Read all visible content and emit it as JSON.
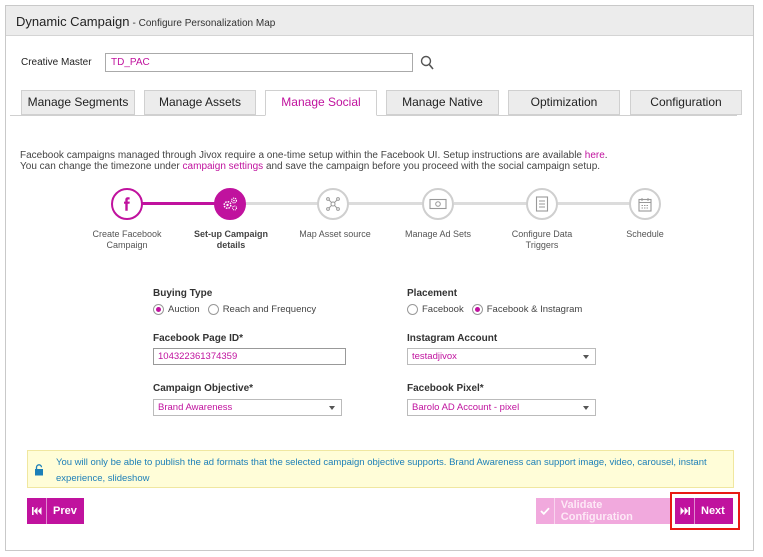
{
  "header": {
    "title": "Dynamic Campaign",
    "subtitle": "- Configure Personalization Map"
  },
  "creative_master": {
    "label": "Creative Master",
    "value": "TD_PAC",
    "search_icon": "search-icon"
  },
  "tabs": [
    {
      "label": "Manage Segments"
    },
    {
      "label": "Manage Assets"
    },
    {
      "label": "Manage Social",
      "active": true
    },
    {
      "label": "Manage Native"
    },
    {
      "label": "Optimization"
    },
    {
      "label": "Configuration"
    }
  ],
  "info": {
    "line1_text": "Facebook campaigns managed through Jivox require a one-time setup within the Facebook UI. Setup instructions are available",
    "line1_link": "here",
    "line1_end": ".",
    "line2_start": "You can change the timezone under",
    "line2_link": "campaign settings",
    "line2_end": "and save the campaign before you proceed with the social campaign setup."
  },
  "steps": [
    {
      "label": "Create Facebook Campaign",
      "icon": "facebook-icon",
      "state": "done"
    },
    {
      "label": "Set-up Campaign details",
      "icon": "settings-gears-icon",
      "state": "current"
    },
    {
      "label": "Map Asset source",
      "icon": "share-nodes-icon",
      "state": "todo"
    },
    {
      "label": "Manage Ad Sets",
      "icon": "money-icon",
      "state": "todo"
    },
    {
      "label": "Configure Data Triggers",
      "icon": "checklist-icon",
      "state": "todo"
    },
    {
      "label": "Schedule",
      "icon": "calendar-icon",
      "state": "todo"
    }
  ],
  "form": {
    "buying_type": {
      "label": "Buying Type",
      "options": [
        "Auction",
        "Reach and Frequency"
      ],
      "selected": "Auction"
    },
    "placement": {
      "label": "Placement",
      "options": [
        "Facebook",
        "Facebook & Instagram"
      ],
      "selected": "Facebook & Instagram"
    },
    "page_id": {
      "label": "Facebook Page ID*",
      "value": "104322361374359"
    },
    "instagram": {
      "label": "Instagram Account",
      "value": "testadjivox"
    },
    "objective": {
      "label": "Campaign Objective*",
      "value": "Brand Awareness"
    },
    "pixel": {
      "label": "Facebook Pixel*",
      "value": "Barolo AD Account - pixel"
    }
  },
  "notice": {
    "icon": "lock-icon",
    "text": "You will only be able to publish the ad formats that the selected campaign objective supports. Brand Awareness can support image, video, carousel, instant experience, slideshow"
  },
  "buttons": {
    "prev": "Prev",
    "validate": "Validate Configuration",
    "next": "Next"
  },
  "colors": {
    "accent": "#c0129e",
    "accent_light": "#f1a9dd",
    "notice_bg": "#fffdd8",
    "highlight": "#e81a14"
  }
}
